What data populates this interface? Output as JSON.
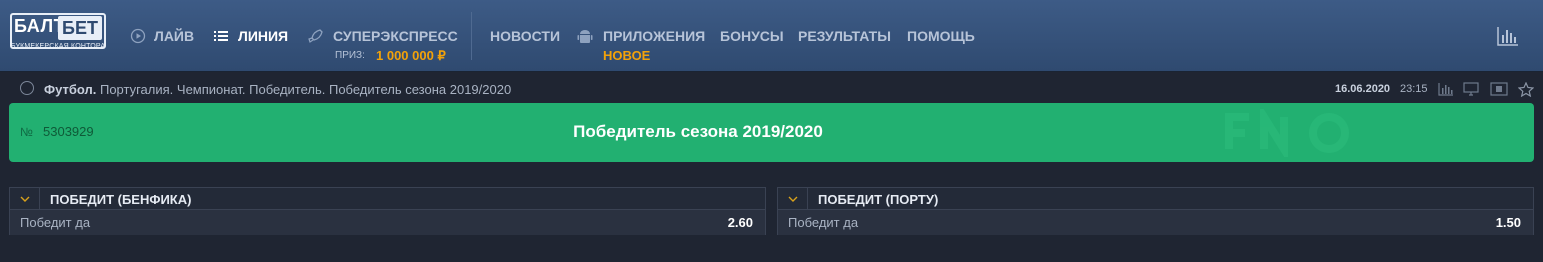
{
  "logo": {
    "line1": "БАЛТ",
    "line2": "БЕТ",
    "sub": "БУКМЕКЕРСКАЯ КОНТОРА"
  },
  "nav": {
    "live": "ЛАЙВ",
    "line": "ЛИНИЯ",
    "superexpress": "СУПЕРЭКСПРЕСС",
    "prize_label": "ПРИЗ:",
    "prize_value": "1 000 000 ₽",
    "news": "НОВОСТИ",
    "apps": "ПРИЛОЖЕНИЯ",
    "apps_badge": "НОВОЕ",
    "bonuses": "БОНУСЫ",
    "results": "РЕЗУЛЬТАТЫ",
    "help": "ПОМОЩЬ"
  },
  "breadcrumb": {
    "sport": "Футбол.",
    "path": " Португалия. Чемпионат. Победитель.  Победитель сезона 2019/2020",
    "date": "16.06.2020",
    "time": "23:15"
  },
  "event": {
    "number_sign": "№",
    "id": "5303929",
    "title": "Победитель сезона 2019/2020"
  },
  "markets": [
    {
      "title": "ПОБЕДИТ (БЕНФИКА)",
      "row_label": "Победит да",
      "odd": "2.60"
    },
    {
      "title": "ПОБЕДИТ (ПОРТУ)",
      "row_label": "Победит да",
      "odd": "1.50"
    }
  ],
  "colors": {
    "header": "#35527c",
    "accent": "#f2a20a",
    "banner": "#22b071",
    "background": "#1f2532"
  },
  "icons": [
    "play-icon",
    "list-icon",
    "rocket-icon",
    "android-icon",
    "stats-icon",
    "football-icon",
    "stats-small-icon",
    "monitor-icon",
    "video-icon",
    "star-icon",
    "chevron-down-icon"
  ]
}
